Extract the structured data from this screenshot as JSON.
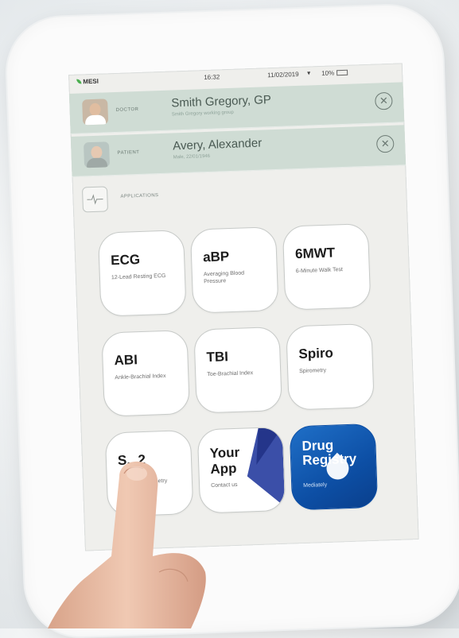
{
  "status": {
    "brand": "MESI",
    "time": "16:32",
    "date": "11/02/2019",
    "battery": "10%"
  },
  "doctor": {
    "role": "DOCTOR",
    "name": "Smith Gregory, GP",
    "group": "Smith Gregory working group"
  },
  "patient": {
    "role": "PATIENT",
    "name": "Avery, Alexander",
    "info": "Male, 22/01/1946"
  },
  "apps": {
    "label": "APPLICATIONS",
    "tiles": [
      {
        "title": "ECG",
        "subtitle": "12-Lead Resting ECG"
      },
      {
        "title": "aBP",
        "subtitle": "Averaging Blood Pressure"
      },
      {
        "title": "6MWT",
        "subtitle": "6-Minute Walk Test"
      },
      {
        "title": "ABI",
        "subtitle": "Ankle-Brachial Index"
      },
      {
        "title": "TBI",
        "subtitle": "Toe-Brachial Index"
      },
      {
        "title": "Spiro",
        "subtitle": "Spirometry"
      },
      {
        "title": "S...2",
        "subtitle": "...metry"
      },
      {
        "title": "Your App",
        "subtitle": "Contact us"
      },
      {
        "title": "Drug Registry",
        "subtitle": "Mediately"
      }
    ]
  },
  "colors": {
    "header_row": "#cfdcd4",
    "screen_bg": "#efefec",
    "drug_tile": "#1565c0",
    "your_app_accent": "#3b4fa8"
  }
}
